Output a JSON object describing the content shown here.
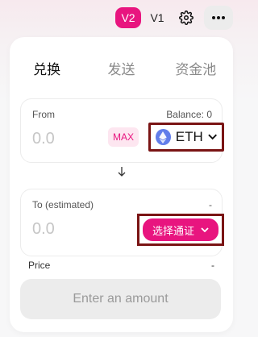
{
  "header": {
    "v2_label": "V2",
    "v1_label": "V1",
    "settings_icon": "gear-icon",
    "more_icon": "more-dots-icon"
  },
  "tabs": [
    "兑换",
    "发送",
    "资金池"
  ],
  "from": {
    "label": "From",
    "balance": "Balance: 0",
    "amount_placeholder": "0.0",
    "max_label": "MAX",
    "token": "ETH"
  },
  "to": {
    "label": "To (estimated)",
    "dash": "-",
    "amount_placeholder": "0.0",
    "select_label": "选择通证"
  },
  "price": {
    "label": "Price",
    "value": "-"
  },
  "action": {
    "label": "Enter an amount"
  },
  "colors": {
    "accent": "#e8157f",
    "highlight_border": "#7a1414",
    "eth": "#627eea"
  }
}
